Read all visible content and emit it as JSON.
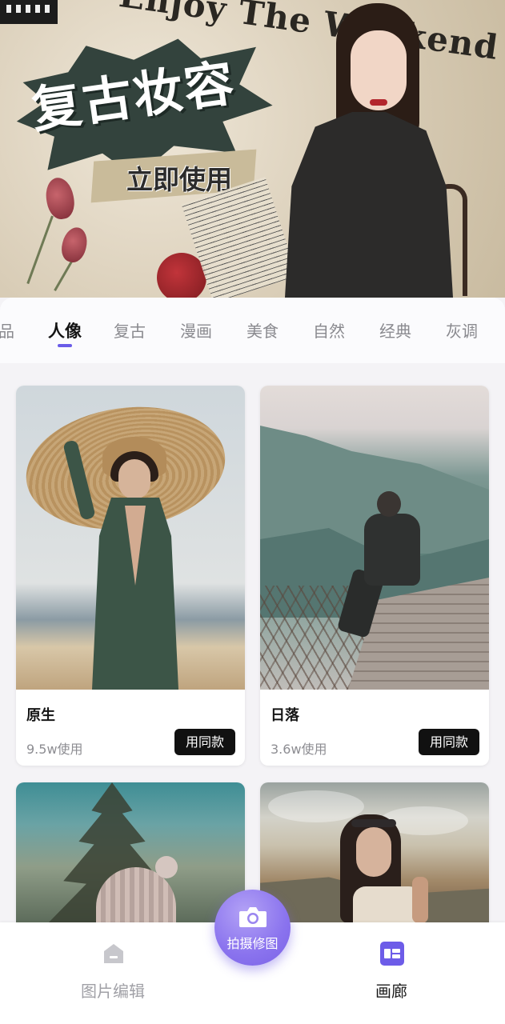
{
  "banner": {
    "title": "复古妆容",
    "cta": "立即使用",
    "overlay_text": "Enjoy The Weekend"
  },
  "tabs": [
    "品",
    "人像",
    "复古",
    "漫画",
    "美食",
    "自然",
    "经典",
    "灰调"
  ],
  "active_tab": "人像",
  "cards": [
    {
      "title": "原生",
      "usage": "9.5w使用",
      "button": "用同款"
    },
    {
      "title": "日落",
      "usage": "3.6w使用",
      "button": "用同款"
    },
    {
      "title": "",
      "usage": "",
      "button": ""
    },
    {
      "title": "",
      "usage": "",
      "button": ""
    }
  ],
  "bottom_nav": {
    "edit_label": "图片编辑",
    "gallery_label": "画廊",
    "fab_label": "拍摄修图",
    "edit_icon": "home-icon",
    "gallery_icon": "gallery-icon",
    "fab_icon": "camera-icon"
  },
  "colors": {
    "accent": "#6d5ce8",
    "button_bg": "#111111",
    "fab_gradient_start": "#b3a2f6",
    "fab_gradient_end": "#7a62e6"
  }
}
